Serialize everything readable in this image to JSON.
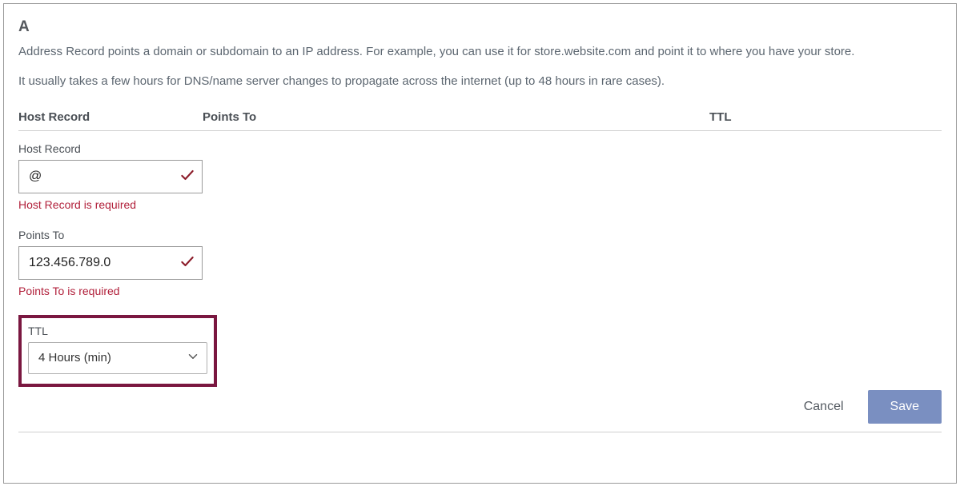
{
  "record_title": "A",
  "description_line1": "Address Record points a domain or subdomain to an IP address. For example, you can use it for store.website.com and point it to where you have your store.",
  "description_line2": "It usually takes a few hours for DNS/name server changes to propagate across the internet (up to 48 hours in rare cases).",
  "columns": {
    "host": "Host Record",
    "points_to": "Points To",
    "ttl": "TTL"
  },
  "fields": {
    "host": {
      "label": "Host Record",
      "value": "@",
      "error": "Host Record is required"
    },
    "points_to": {
      "label": "Points To",
      "value": "123.456.789.0",
      "error": "Points To is required"
    },
    "ttl": {
      "label": "TTL",
      "value": "4 Hours (min)"
    }
  },
  "actions": {
    "cancel": "Cancel",
    "save": "Save"
  }
}
